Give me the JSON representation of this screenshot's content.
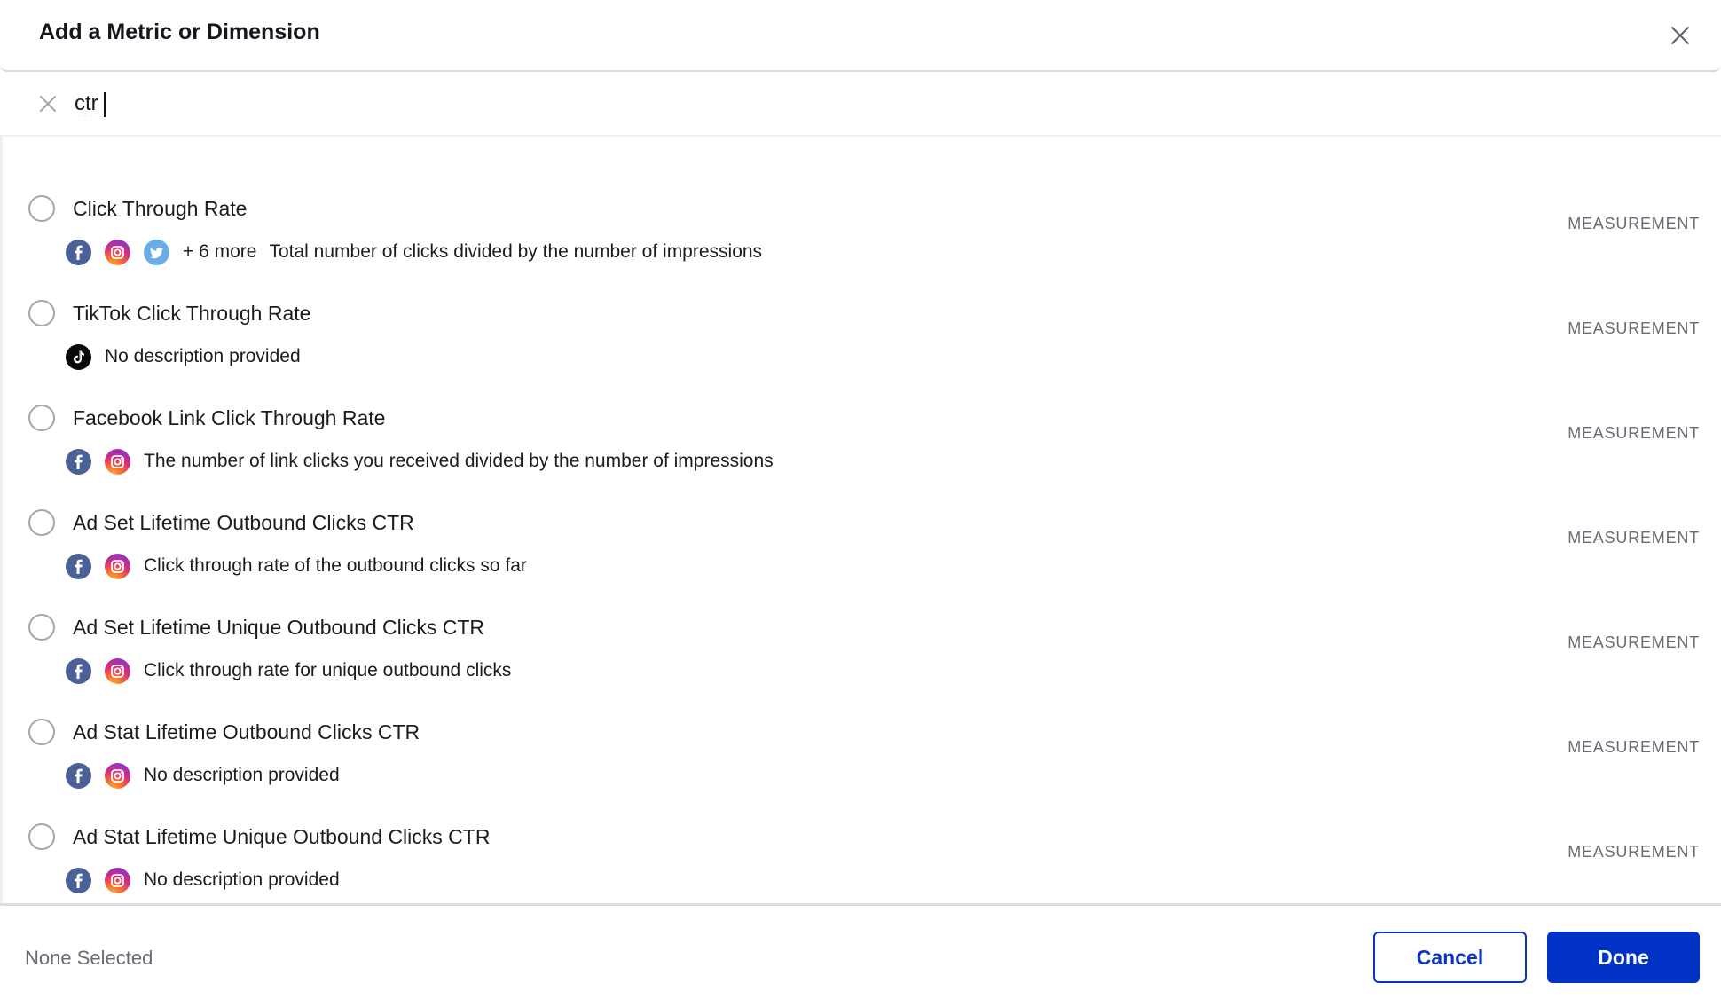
{
  "dialog": {
    "title": "Add a Metric or Dimension",
    "close_icon": "close-icon"
  },
  "search": {
    "value": "ctr",
    "placeholder": "",
    "clear_icon": "clear-icon"
  },
  "results": [
    {
      "title": "Click Through Rate",
      "networks": [
        "facebook",
        "instagram",
        "twitter"
      ],
      "more": "+ 6 more",
      "description": "Total number of clicks divided by the number of impressions",
      "type": "MEASUREMENT"
    },
    {
      "title": "TikTok Click Through Rate",
      "networks": [
        "tiktok"
      ],
      "more": "",
      "description": "No description provided",
      "type": "MEASUREMENT"
    },
    {
      "title": "Facebook Link Click Through Rate",
      "networks": [
        "facebook",
        "instagram"
      ],
      "more": "",
      "description": "The number of link clicks you received divided by the number of impressions",
      "type": "MEASUREMENT"
    },
    {
      "title": "Ad Set Lifetime Outbound Clicks CTR",
      "networks": [
        "facebook",
        "instagram"
      ],
      "more": "",
      "description": "Click through rate of the outbound clicks so far",
      "type": "MEASUREMENT"
    },
    {
      "title": "Ad Set Lifetime Unique Outbound Clicks CTR",
      "networks": [
        "facebook",
        "instagram"
      ],
      "more": "",
      "description": "Click through rate for unique outbound clicks",
      "type": "MEASUREMENT"
    },
    {
      "title": "Ad Stat Lifetime Outbound Clicks CTR",
      "networks": [
        "facebook",
        "instagram"
      ],
      "more": "",
      "description": "No description provided",
      "type": "MEASUREMENT"
    },
    {
      "title": "Ad Stat Lifetime Unique Outbound Clicks CTR",
      "networks": [
        "facebook",
        "instagram"
      ],
      "more": "",
      "description": "No description provided",
      "type": "MEASUREMENT"
    }
  ],
  "footer": {
    "selection_status": "None Selected",
    "cancel_label": "Cancel",
    "done_label": "Done"
  },
  "colors": {
    "primary": "#0033c5",
    "facebook": "#4a6097",
    "twitter": "#69ace8",
    "tiktok": "#0a0a0a"
  }
}
